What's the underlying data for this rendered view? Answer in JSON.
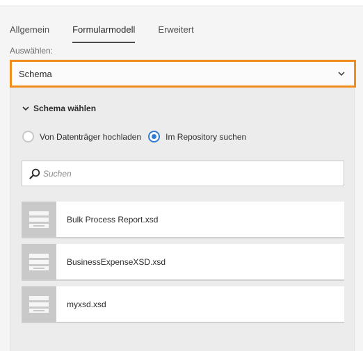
{
  "tabs": [
    {
      "label": "Allgemein"
    },
    {
      "label": "Formularmodell"
    },
    {
      "label": "Erweitert"
    }
  ],
  "select": {
    "label": "Auswählen:",
    "value": "Schema"
  },
  "section": {
    "title": "Schema wählen",
    "radios": [
      {
        "label": "Von Datenträger hochladen",
        "checked": false
      },
      {
        "label": "Im Repository suchen",
        "checked": true
      }
    ],
    "search": {
      "placeholder": "Suchen",
      "value": ""
    },
    "items": [
      {
        "name": "Bulk Process Report.xsd"
      },
      {
        "name": "BusinessExpenseXSD.xsd"
      },
      {
        "name": "myxsd.xsd"
      }
    ]
  },
  "colors": {
    "focus_border": "#f28c1c",
    "radio_accent": "#2f7dd3"
  },
  "icons": {
    "dropdown": "chevron-down-icon",
    "section_toggle": "chevron-down-icon",
    "search": "search-icon",
    "file": "document-icon"
  }
}
